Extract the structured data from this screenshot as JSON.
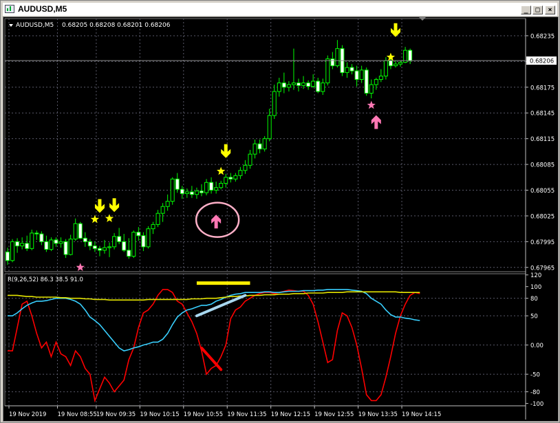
{
  "window": {
    "title": "AUDUSD,M5",
    "minimize_glyph": "_",
    "restore_glyph": "□",
    "close_glyph": "×"
  },
  "colors": {
    "background": "#000000",
    "grid": "#5a5a6a",
    "candle_up": "#00ff00",
    "candle_down_fill": "#ffffff",
    "text": "#ffffff",
    "red_line": "#ff0000",
    "cyan_line": "#39d0ff",
    "yellow_line": "#e6e600",
    "arrow_yellow": "#ffff00",
    "star_pink": "#ff78b4",
    "arrow_pink": "#ff78b4",
    "circle_pink": "#ffb0c8",
    "annotation_light_blue": "#a8d8f0"
  },
  "chart_data": [
    {
      "type": "candlestick",
      "title": "AUDUSD,M5",
      "info": "0.68205 0.68208 0.68201 0.68206",
      "ylim": [
        0.6796,
        0.68255
      ],
      "yticks": [
        "0.68235",
        "0.68205",
        "0.68175",
        "0.68145",
        "0.68115",
        "0.68085",
        "0.68055",
        "0.68025",
        "0.67995",
        "0.67965"
      ],
      "current_price": "0.68206",
      "xticks": [
        "19 Nov 2019",
        "19 Nov 08:55",
        "19 Nov 09:35",
        "19 Nov 10:15",
        "19 Nov 10:55",
        "19 Nov 11:35",
        "19 Nov 12:15",
        "19 Nov 12:55",
        "19 Nov 13:35",
        "19 Nov 14:15"
      ],
      "ohlc": [
        [
          0.67983,
          0.67988,
          0.67968,
          0.67973
        ],
        [
          0.67973,
          0.67998,
          0.67971,
          0.67995
        ],
        [
          0.67995,
          0.67999,
          0.67982,
          0.6799
        ],
        [
          0.6799,
          0.68,
          0.67986,
          0.67993
        ],
        [
          0.67993,
          0.68002,
          0.67984,
          0.67987
        ],
        [
          0.67987,
          0.68009,
          0.67985,
          0.68005
        ],
        [
          0.68005,
          0.68008,
          0.67997,
          0.68004
        ],
        [
          0.68004,
          0.68007,
          0.67991,
          0.67995
        ],
        [
          0.67995,
          0.68002,
          0.67983,
          0.67986
        ],
        [
          0.67986,
          0.68,
          0.67984,
          0.67997
        ],
        [
          0.67997,
          0.68,
          0.67989,
          0.67993
        ],
        [
          0.67993,
          0.68,
          0.67988,
          0.67995
        ],
        [
          0.67995,
          0.67998,
          0.67976,
          0.6798
        ],
        [
          0.6798,
          0.68003,
          0.67979,
          0.67998
        ],
        [
          0.67998,
          0.68022,
          0.67996,
          0.68016
        ],
        [
          0.68016,
          0.68018,
          0.67998,
          0.67999
        ],
        [
          0.67999,
          0.68006,
          0.67989,
          0.67995
        ],
        [
          0.67995,
          0.67998,
          0.67985,
          0.6799
        ],
        [
          0.6799,
          0.67995,
          0.67983,
          0.67987
        ],
        [
          0.67987,
          0.6799,
          0.67978,
          0.67985
        ],
        [
          0.67985,
          0.67997,
          0.67981,
          0.67988
        ],
        [
          0.67988,
          0.67994,
          0.67977,
          0.67989
        ],
        [
          0.67989,
          0.68005,
          0.67986,
          0.68001
        ],
        [
          0.68001,
          0.68011,
          0.67992,
          0.67995
        ],
        [
          0.67995,
          0.68004,
          0.67983,
          0.67985
        ],
        [
          0.67985,
          0.67999,
          0.67975,
          0.67978
        ],
        [
          0.67978,
          0.68008,
          0.67976,
          0.68006
        ],
        [
          0.68006,
          0.68012,
          0.67996,
          0.68002
        ],
        [
          0.68002,
          0.68006,
          0.67984,
          0.67989
        ],
        [
          0.67989,
          0.68013,
          0.67987,
          0.6801
        ],
        [
          0.6801,
          0.68018,
          0.68004,
          0.68015
        ],
        [
          0.68015,
          0.68032,
          0.68012,
          0.68028
        ],
        [
          0.68028,
          0.6804,
          0.68018,
          0.68036
        ],
        [
          0.68036,
          0.6805,
          0.68031,
          0.68042
        ],
        [
          0.68042,
          0.6807,
          0.68038,
          0.68068
        ],
        [
          0.68068,
          0.68075,
          0.68052,
          0.68056
        ],
        [
          0.68056,
          0.6806,
          0.68045,
          0.68051
        ],
        [
          0.68051,
          0.68057,
          0.68046,
          0.68053
        ],
        [
          0.68053,
          0.6806,
          0.68046,
          0.6805
        ],
        [
          0.6805,
          0.68058,
          0.68045,
          0.68054
        ],
        [
          0.68054,
          0.68062,
          0.68048,
          0.68052
        ],
        [
          0.68052,
          0.68068,
          0.68049,
          0.68064
        ],
        [
          0.68064,
          0.6807,
          0.68051,
          0.68055
        ],
        [
          0.68055,
          0.68065,
          0.68051,
          0.68058
        ],
        [
          0.68058,
          0.68066,
          0.68056,
          0.68063
        ],
        [
          0.68063,
          0.68074,
          0.68058,
          0.6807
        ],
        [
          0.6807,
          0.68075,
          0.68064,
          0.68068
        ],
        [
          0.68068,
          0.68075,
          0.68065,
          0.68072
        ],
        [
          0.68072,
          0.68082,
          0.68068,
          0.68078
        ],
        [
          0.68078,
          0.6809,
          0.68074,
          0.68084
        ],
        [
          0.68084,
          0.68102,
          0.6808,
          0.68097
        ],
        [
          0.68097,
          0.68114,
          0.68092,
          0.68109
        ],
        [
          0.68109,
          0.68114,
          0.68098,
          0.68103
        ],
        [
          0.68103,
          0.68118,
          0.681,
          0.68115
        ],
        [
          0.68115,
          0.6815,
          0.68112,
          0.68142
        ],
        [
          0.68142,
          0.68178,
          0.68138,
          0.6817
        ],
        [
          0.6817,
          0.68186,
          0.68164,
          0.6818
        ],
        [
          0.6818,
          0.68192,
          0.68168,
          0.68175
        ],
        [
          0.68175,
          0.68182,
          0.6817,
          0.68178
        ],
        [
          0.68178,
          0.6822,
          0.68172,
          0.6818
        ],
        [
          0.6818,
          0.68185,
          0.6817,
          0.68177
        ],
        [
          0.68177,
          0.68188,
          0.68173,
          0.6818
        ],
        [
          0.6818,
          0.68183,
          0.68172,
          0.68176
        ],
        [
          0.68176,
          0.6819,
          0.68174,
          0.68182
        ],
        [
          0.68182,
          0.68186,
          0.68168,
          0.6817
        ],
        [
          0.6817,
          0.68185,
          0.68166,
          0.6818
        ],
        [
          0.6818,
          0.68212,
          0.68177,
          0.68208
        ],
        [
          0.68208,
          0.68216,
          0.68196,
          0.682
        ],
        [
          0.682,
          0.6823,
          0.68198,
          0.6822
        ],
        [
          0.6822,
          0.68224,
          0.68188,
          0.68192
        ],
        [
          0.68192,
          0.68204,
          0.68186,
          0.68198
        ],
        [
          0.68198,
          0.68202,
          0.6819,
          0.68194
        ],
        [
          0.68194,
          0.682,
          0.68176,
          0.68184
        ],
        [
          0.68184,
          0.682,
          0.6818,
          0.68195
        ],
        [
          0.68195,
          0.68198,
          0.68165,
          0.68168
        ],
        [
          0.68168,
          0.68184,
          0.68162,
          0.68178
        ],
        [
          0.68178,
          0.68186,
          0.68172,
          0.68184
        ],
        [
          0.68184,
          0.68196,
          0.68181,
          0.68188
        ],
        [
          0.68188,
          0.6821,
          0.68184,
          0.68206
        ],
        [
          0.68206,
          0.68208,
          0.68196,
          0.682
        ],
        [
          0.682,
          0.68206,
          0.68198,
          0.68202
        ],
        [
          0.68202,
          0.68206,
          0.68199,
          0.68204
        ],
        [
          0.68204,
          0.68222,
          0.68203,
          0.68218
        ],
        [
          0.68218,
          0.6822,
          0.68202,
          0.68206
        ]
      ],
      "markers": [
        {
          "type": "arrow-down-yellow",
          "index": 19,
          "price": 0.68035
        },
        {
          "type": "arrow-down-yellow",
          "index": 22,
          "price": 0.68036
        },
        {
          "type": "arrow-down-yellow",
          "index": 45,
          "price": 0.68099
        },
        {
          "type": "arrow-down-yellow",
          "index": 80,
          "price": 0.6824
        },
        {
          "type": "star-yellow",
          "index": 18,
          "price": 0.68021
        },
        {
          "type": "star-yellow",
          "index": 21,
          "price": 0.68022
        },
        {
          "type": "star-yellow",
          "index": 44,
          "price": 0.68077
        },
        {
          "type": "star-yellow",
          "index": 79,
          "price": 0.6821
        },
        {
          "type": "star-pink",
          "index": 15,
          "price": 0.67965
        },
        {
          "type": "star-pink",
          "index": 75,
          "price": 0.68154
        },
        {
          "type": "arrow-up-pink",
          "index": 43,
          "price": 0.6802
        },
        {
          "type": "arrow-up-pink",
          "index": 76,
          "price": 0.68136
        }
      ],
      "annotation_circle": {
        "index": 43,
        "price": 0.68022
      }
    },
    {
      "type": "line",
      "title": "R(9,26,52) 86.3 38.5 91.0",
      "ylim": [
        -104,
        122
      ],
      "yticks": [
        "120",
        "100",
        "80",
        "50",
        "0.00",
        "-50",
        "-80",
        "-100"
      ],
      "series": [
        {
          "color": "#ff0000",
          "values": [
            -10,
            -10,
            30,
            70,
            75,
            50,
            20,
            -5,
            5,
            -20,
            5,
            -15,
            -20,
            -35,
            -10,
            -20,
            -40,
            -50,
            -95,
            -75,
            -55,
            -65,
            -80,
            -70,
            -60,
            -25,
            -5,
            30,
            55,
            60,
            70,
            85,
            95,
            95,
            90,
            75,
            70,
            55,
            40,
            20,
            -10,
            -50,
            -40,
            -35,
            -20,
            0,
            45,
            60,
            65,
            75,
            80,
            85,
            88,
            90,
            90,
            88,
            90,
            92,
            94,
            93,
            92,
            92,
            85,
            70,
            40,
            5,
            -30,
            -25,
            25,
            55,
            50,
            30,
            0,
            -40,
            -85,
            -95,
            -95,
            -85,
            -55,
            -20,
            20,
            50,
            70,
            85,
            90,
            88
          ]
        },
        {
          "color": "#39d0ff",
          "values": [
            50,
            50,
            55,
            62,
            68,
            72,
            75,
            75,
            76,
            78,
            80,
            80,
            80,
            78,
            75,
            70,
            60,
            48,
            42,
            35,
            25,
            15,
            5,
            -5,
            -10,
            -8,
            -5,
            -3,
            0,
            2,
            5,
            5,
            10,
            20,
            35,
            48,
            55,
            60,
            62,
            65,
            68,
            68,
            70,
            75,
            78,
            82,
            85,
            87,
            88,
            90,
            90,
            90,
            90,
            91,
            91,
            90,
            90,
            91,
            92,
            92,
            92,
            93,
            93,
            93,
            94,
            94,
            95,
            95,
            95,
            95,
            95,
            94,
            93,
            92,
            88,
            80,
            75,
            70,
            60,
            52,
            48,
            48,
            46,
            45,
            43,
            42
          ]
        },
        {
          "color": "#e6e600",
          "values": [
            85,
            85,
            85,
            84,
            83,
            83,
            82,
            82,
            82,
            82,
            82,
            81,
            81,
            80,
            80,
            80,
            79,
            79,
            78,
            78,
            78,
            77,
            77,
            77,
            77,
            77,
            77,
            77,
            77,
            78,
            78,
            78,
            78,
            78,
            78,
            78,
            78,
            78,
            79,
            79,
            79,
            80,
            80,
            80,
            81,
            82,
            83,
            83,
            84,
            84,
            85,
            85,
            85,
            86,
            86,
            86,
            87,
            87,
            87,
            88,
            88,
            88,
            89,
            89,
            89,
            89,
            90,
            90,
            90,
            90,
            91,
            91,
            91,
            91,
            91,
            91,
            91,
            91,
            91,
            91,
            91,
            90,
            90,
            90,
            90,
            90
          ]
        }
      ],
      "annotations": [
        {
          "type": "horizontal-bar",
          "color": "#ffee00",
          "from_index": 39,
          "to_index": 50,
          "value": 106
        },
        {
          "type": "trend-line",
          "color": "#ff0000",
          "from": [
            40,
            -5
          ],
          "to": [
            44,
            -42
          ]
        },
        {
          "type": "trend-line",
          "color": "#a8d8f0",
          "from": [
            39,
            50
          ],
          "to": [
            49,
            85
          ]
        }
      ]
    }
  ]
}
